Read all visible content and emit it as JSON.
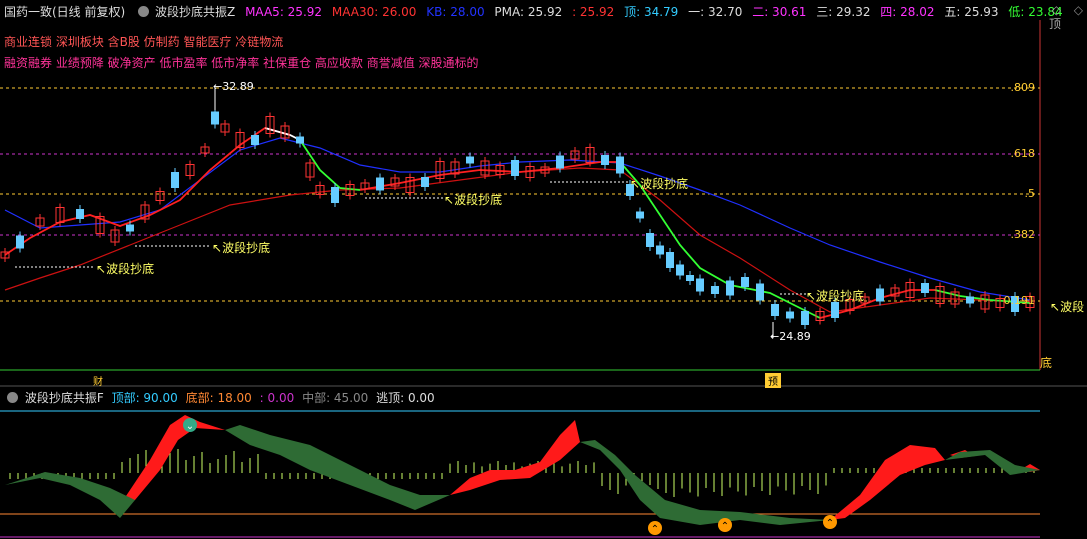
{
  "header": {
    "title": "国药一致(日线 前复权)",
    "indicator_name": "波段抄底共振Z",
    "maa5_label": "MAA5: 25.92",
    "maa30_label": "MAA30: 26.00",
    "kb_label": "KB: 28.00",
    "pma_label": "PMA: 25.92",
    "pma2_label": ": 25.92",
    "top_label": "顶: 34.79",
    "l1_label": "一: 32.70",
    "l2_label": "二: 30.61",
    "l3_label": "三: 29.32",
    "l4_label": "四: 28.02",
    "l5_label": "五: 25.93",
    "low_label": "低: 23.84",
    "right_top": "顶",
    "right_bottom": "底"
  },
  "concepts": {
    "line1": "商业连锁 深圳板块 含B股 仿制药 智能医疗 冷链物流",
    "line2": "融资融券 业绩预降 破净资产 低市盈率 低市净率 社保重仓 高应收款 商誉减值 深股通标的"
  },
  "price_levels": [
    ".809",
    ".618",
    ".5",
    ".382",
    "0.191"
  ],
  "annotations": {
    "high": "32.89",
    "low": "24.89",
    "signal": "波段抄底",
    "signal_cut": "波段"
  },
  "markers": {
    "cai": "财",
    "yu": "预"
  },
  "sub": {
    "name": "波段抄底共振F",
    "top_label": "顶部: 90.00",
    "bottom_label": "底部: 18.00",
    "zero_label": ": 0.00",
    "mid_label": "中部: 45.00",
    "escape_label": "逃顶: 0.00"
  },
  "colors": {
    "bg": "#000000",
    "up": "#ff3333",
    "down": "#66ccff",
    "ma_red": "#ff2020",
    "ma_green": "#33ff33",
    "ma_blue": "#2030ff",
    "ma_slow": "#cc1111",
    "level_yellow": "#ffcc33",
    "level_magenta": "#cc33cc",
    "band_red": "#ff1a1a",
    "band_green": "#2e6b34"
  }
}
